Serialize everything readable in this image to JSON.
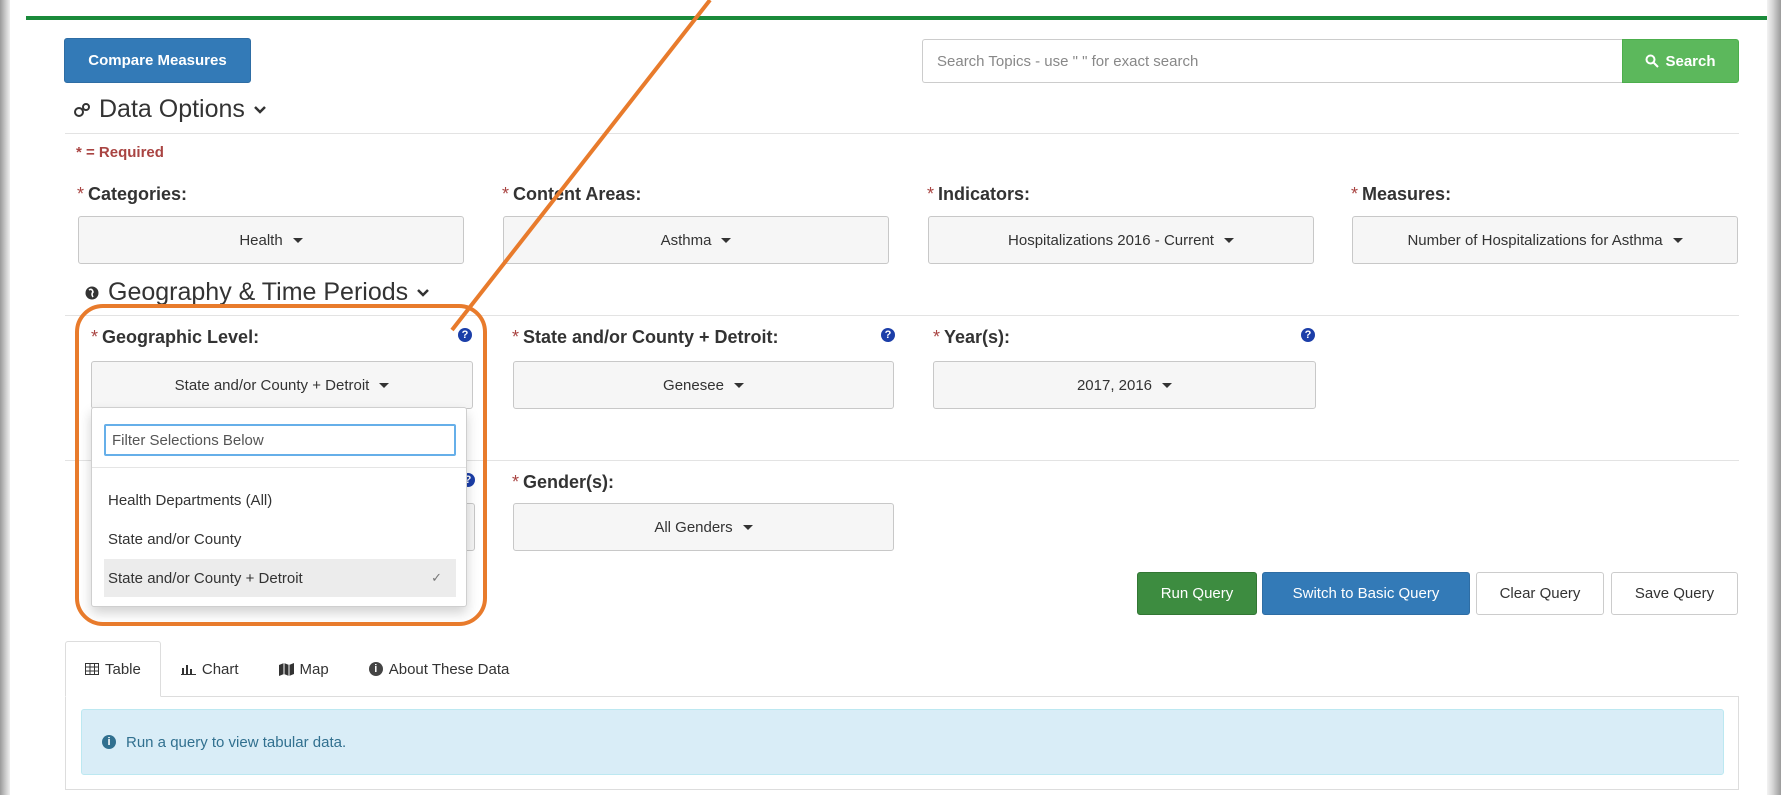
{
  "toolbar": {
    "compare_label": "Compare Measures",
    "search_placeholder": "Search Topics - use \" \" for exact search",
    "search_label": "Search"
  },
  "data_options": {
    "title": "Data Options",
    "required_note": "* = Required",
    "fields": [
      {
        "label": "Categories:",
        "value": "Health"
      },
      {
        "label": "Content Areas:",
        "value": "Asthma"
      },
      {
        "label": "Indicators:",
        "value": "Hospitalizations 2016 - Current"
      },
      {
        "label": "Measures:",
        "value": "Number of Hospitalizations for Asthma"
      }
    ]
  },
  "geography": {
    "title": "Geography & Time Periods",
    "fields": [
      {
        "label": "Geographic Level:",
        "value": "State and/or County + Detroit"
      },
      {
        "label": "State and/or County + Detroit:",
        "value": "Genesee"
      },
      {
        "label": "Year(s):",
        "value": "2017, 2016"
      }
    ]
  },
  "dropdown": {
    "filter_placeholder": "Filter Selections Below",
    "options": [
      "Health Departments (All)",
      "State and/or County",
      "State and/or County + Detroit"
    ],
    "selected": "State and/or County + Detroit"
  },
  "demographics": {
    "gender_label": "Gender(s):",
    "gender_value": "All Genders"
  },
  "actions": {
    "run": "Run Query",
    "switch": "Switch to Basic Query",
    "clear": "Clear Query",
    "save": "Save Query"
  },
  "tabs": [
    "Table",
    "Chart",
    "Map",
    "About These Data"
  ],
  "info_message": "Run a query to view tabular data.",
  "colors": {
    "primary": "#337ab7",
    "success": "#3d8c40",
    "highlight": "#e87b2c",
    "required": "#a94442"
  }
}
